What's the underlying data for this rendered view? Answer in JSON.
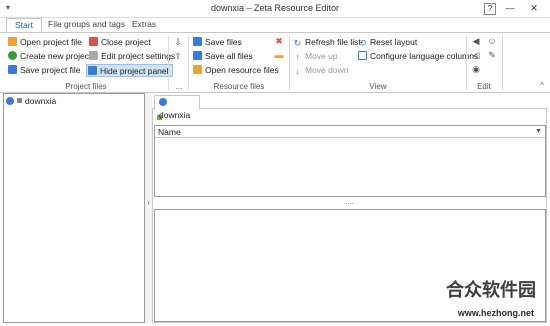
{
  "window": {
    "title": "downxia – Zeta Resource Editor",
    "quick_access": "▾",
    "help": "?",
    "minimize": "—",
    "close": "✕"
  },
  "tabs": [
    {
      "label": "Start",
      "active": true
    },
    {
      "label": "File groups and tags",
      "active": false
    },
    {
      "label": "Extras",
      "active": false
    }
  ],
  "ribbon": {
    "project_files": {
      "label": "Project files",
      "open_project_file": "Open project file",
      "create_new_project": "Create new project",
      "save_project_file": "Save project file",
      "close_project": "Close project",
      "edit_project_settings": "Edit project settings",
      "hide_project_panel": "Hide project panel"
    },
    "ellipsis_group": {
      "label": "..."
    },
    "resource_files": {
      "label": "Resource files",
      "save_files": "Save files",
      "save_all_files": "Save all files",
      "open_resource_files": "Open resource files"
    },
    "view": {
      "label": "View",
      "refresh_file_list": "Refresh file list",
      "move_up": "Move up",
      "move_down": "Move down",
      "reset_layout": "Reset layout",
      "configure_language_columns": "Configure language columns"
    },
    "edit": {
      "label": "Edit"
    },
    "collapse": "^"
  },
  "project_panel": {
    "project_name": "downxia"
  },
  "document": {
    "tab_label": "downxia",
    "grid_header": "Name",
    "splitter_grip": "....",
    "collapse_arrow": "‹"
  },
  "watermark": {
    "text": "合众软件园",
    "url": "www.hezhong.net"
  },
  "icons": {
    "accent": "#1e5fa8",
    "highlight": "#cde4f7"
  }
}
